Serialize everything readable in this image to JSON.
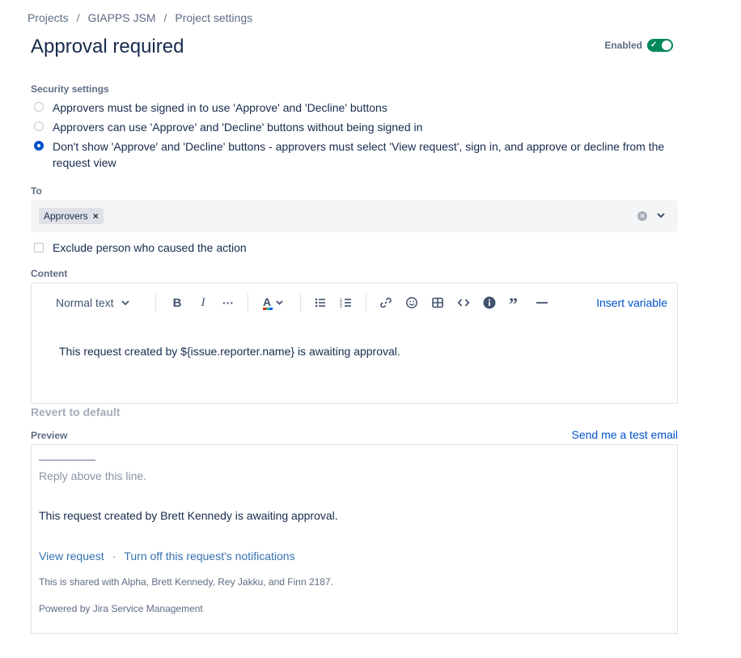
{
  "breadcrumb": [
    "Projects",
    "GIAPPS JSM",
    "Project settings"
  ],
  "breadcrumb_separator": "/",
  "title": "Approval required",
  "enabled": {
    "label": "Enabled",
    "on": true,
    "color": "#00875A"
  },
  "security": {
    "label": "Security settings",
    "options": [
      {
        "text": "Approvers must be signed in to use 'Approve' and 'Decline' buttons",
        "checked": false
      },
      {
        "text": "Approvers can use 'Approve' and 'Decline' buttons without being signed in",
        "checked": false
      },
      {
        "text": "Don't show 'Approve' and 'Decline' buttons - approvers must select 'View request', sign in, and approve or decline from the request view",
        "checked": true
      }
    ]
  },
  "to": {
    "label": "To",
    "tags": [
      "Approvers"
    ],
    "tag_remove": "×"
  },
  "exclude": {
    "label": "Exclude person who caused the action",
    "checked": false
  },
  "content": {
    "label": "Content",
    "toolbar": {
      "text_style": "Normal text",
      "bold": "B",
      "italic": "I",
      "more": "···",
      "insert_variable": "Insert variable"
    },
    "body": "This request created by ${issue.reporter.name} is awaiting approval."
  },
  "revert": "Revert to default",
  "preview": {
    "label": "Preview",
    "send_test": "Send me a test email",
    "reply_line": "Reply above this line.",
    "body": "This request created by Brett Kennedy is awaiting approval.",
    "view_request": "View request",
    "separator": "·",
    "turn_off": "Turn off this request's notifications",
    "shared": "This is shared with Alpha, Brett Kennedy, Rey Jakku, and Finn 2187.",
    "powered": "Powered by Jira Service Management"
  },
  "colors": {
    "accent": "#0052CC",
    "text": "#172B4D",
    "muted": "#5E6C84"
  }
}
